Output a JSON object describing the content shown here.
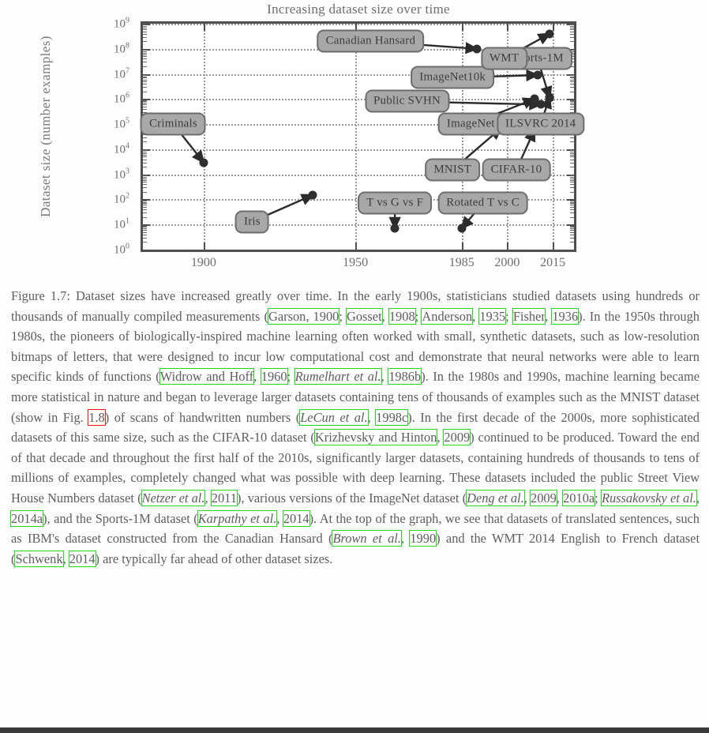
{
  "chart_data": {
    "type": "scatter",
    "title": "Increasing dataset size over time",
    "xlabel": "",
    "ylabel": "Dataset size (number examples)",
    "yscale": "log",
    "ylim": [
      1,
      1000000000
    ],
    "xlim": [
      1880,
      2022
    ],
    "grid": true,
    "legend": "none",
    "ytick_labels": [
      "10^0",
      "10^1",
      "10^2",
      "10^3",
      "10^4",
      "10^5",
      "10^6",
      "10^7",
      "10^8",
      "10^9"
    ],
    "ytick_exponents": [
      "0",
      "1",
      "2",
      "3",
      "4",
      "5",
      "6",
      "7",
      "8",
      "9"
    ],
    "xtick_labels": [
      "1900",
      "1950",
      "1985",
      "2000",
      "2015"
    ],
    "xtick_values": [
      1900,
      1950,
      1985,
      2000,
      2015
    ],
    "points": [
      {
        "label": "Criminals",
        "x": 1900,
        "y": 3000,
        "label_x": 1890,
        "label_y": 100000
      },
      {
        "label": "Iris",
        "x": 1936,
        "y": 150,
        "label_x": 1916,
        "label_y": 13
      },
      {
        "label": "T vs G vs F",
        "x": 1963,
        "y": 7,
        "label_x": 1963,
        "label_y": 70
      },
      {
        "label": "Rotated T vs C",
        "x": 1985,
        "y": 7,
        "label_x": 1992,
        "label_y": 70
      },
      {
        "label": "MNIST",
        "x": 1998,
        "y": 70000,
        "label_x": 1982,
        "label_y": 1500
      },
      {
        "label": "CIFAR-10",
        "x": 2009,
        "y": 60000,
        "label_x": 2003,
        "label_y": 1500
      },
      {
        "label": "ImageNet",
        "x": 2009,
        "y": 1000000,
        "label_x": 1988,
        "label_y": 100000
      },
      {
        "label": "Public SVHN",
        "x": 2011,
        "y": 600000,
        "label_x": 1967,
        "label_y": 800000
      },
      {
        "label": "ILSVRC 2014",
        "x": 2014,
        "y": 1200000,
        "label_x": 2011,
        "label_y": 100000
      },
      {
        "label": "ImageNet10k",
        "x": 2010,
        "y": 9000000,
        "label_x": 1982,
        "label_y": 7000000
      },
      {
        "label": "Sports-1M",
        "x": 2014,
        "y": 1100000,
        "label_x": 2010,
        "label_y": 40000000
      },
      {
        "label": "WMT",
        "x": 2014,
        "y": 400000000,
        "label_x": 1999,
        "label_y": 40000000
      },
      {
        "label": "Canadian Hansard",
        "x": 1990,
        "y": 100000000,
        "label_x": 1955,
        "label_y": 200000000
      }
    ],
    "colors": {
      "marker": "#2f2f2f",
      "label_fill": "#a8a8a8",
      "label_border": "#6d6d6d",
      "axis": "#4f4f4f",
      "grid": "#9a9a9a",
      "text": "#6f6f6f"
    }
  },
  "caption": {
    "figure_number": "Figure 1.7:",
    "parts": [
      {
        "t": "Figure 1.7: Dataset sizes have increased greatly over time. In the early 1900s, statisticians studied datasets using hundreds or thousands of manually compiled measurements ("
      },
      {
        "t": "Garson, 1900",
        "c": "green"
      },
      {
        "t": "; "
      },
      {
        "t": "Gosset",
        "c": "green"
      },
      {
        "t": ", "
      },
      {
        "t": "1908",
        "c": "green"
      },
      {
        "t": "; "
      },
      {
        "t": "Anderson",
        "c": "green"
      },
      {
        "t": ", "
      },
      {
        "t": "1935",
        "c": "green"
      },
      {
        "t": "; "
      },
      {
        "t": "Fisher",
        "c": "green"
      },
      {
        "t": ", "
      },
      {
        "t": "1936",
        "c": "green"
      },
      {
        "t": "). In the 1950s through 1980s, the pioneers of biologically-inspired machine learning often worked with small, synthetic datasets, such as low-resolution bitmaps of letters, that were designed to incur low computational cost and demonstrate that neural networks were able to learn specific kinds of functions ("
      },
      {
        "t": "Widrow and Hoff",
        "c": "green"
      },
      {
        "t": ", "
      },
      {
        "t": "1960",
        "c": "green"
      },
      {
        "t": "; "
      },
      {
        "t": "Rumelhart et al.",
        "c": "green",
        "i": true
      },
      {
        "t": ", "
      },
      {
        "t": "1986b",
        "c": "green"
      },
      {
        "t": "). In the 1980s and 1990s, machine learning became more statistical in nature and began to leverage larger datasets containing tens of thousands of examples such as the MNIST dataset (show in Fig. "
      },
      {
        "t": "1.8",
        "c": "red"
      },
      {
        "t": ") of scans of handwritten numbers ("
      },
      {
        "t": "LeCun et al.",
        "c": "green",
        "i": true
      },
      {
        "t": ", "
      },
      {
        "t": "1998c",
        "c": "green"
      },
      {
        "t": "). In the first decade of the 2000s, more sophisticated datasets of this same size, such as the CIFAR-10 dataset ("
      },
      {
        "t": "Krizhevsky and Hinton",
        "c": "green"
      },
      {
        "t": ", "
      },
      {
        "t": "2009",
        "c": "green"
      },
      {
        "t": ") continued to be produced. Toward the end of that decade and throughout the first half of the 2010s, significantly larger datasets, containing hundreds of thousands to tens of millions of examples, completely changed what was possible with deep learning. These datasets included the public Street View House Numbers dataset ("
      },
      {
        "t": "Netzer et al.",
        "c": "green",
        "i": true
      },
      {
        "t": ", "
      },
      {
        "t": "2011",
        "c": "green"
      },
      {
        "t": "), various versions of the ImageNet dataset ("
      },
      {
        "t": "Deng et al.",
        "c": "green",
        "i": true
      },
      {
        "t": ", "
      },
      {
        "t": "2009",
        "c": "green"
      },
      {
        "t": ", "
      },
      {
        "t": "2010a",
        "c": "green"
      },
      {
        "t": "; "
      },
      {
        "t": "Russakovsky et al.",
        "c": "green",
        "i": true
      },
      {
        "t": ", "
      },
      {
        "t": "2014a",
        "c": "green"
      },
      {
        "t": "), and the Sports-1M dataset ("
      },
      {
        "t": "Karpathy et al.",
        "c": "green",
        "i": true
      },
      {
        "t": ", "
      },
      {
        "t": "2014",
        "c": "green"
      },
      {
        "t": "). At the top of the graph, we see that datasets of translated sentences, such as IBM's dataset constructed from the Canadian Hansard ("
      },
      {
        "t": "Brown et al.",
        "c": "green",
        "i": true
      },
      {
        "t": ", "
      },
      {
        "t": "1990",
        "c": "green"
      },
      {
        "t": ") and the WMT 2014 English to French dataset ("
      },
      {
        "t": "Schwenk",
        "c": "green"
      },
      {
        "t": ", "
      },
      {
        "t": "2014",
        "c": "green"
      },
      {
        "t": ") are typically far ahead of other dataset sizes."
      }
    ]
  }
}
